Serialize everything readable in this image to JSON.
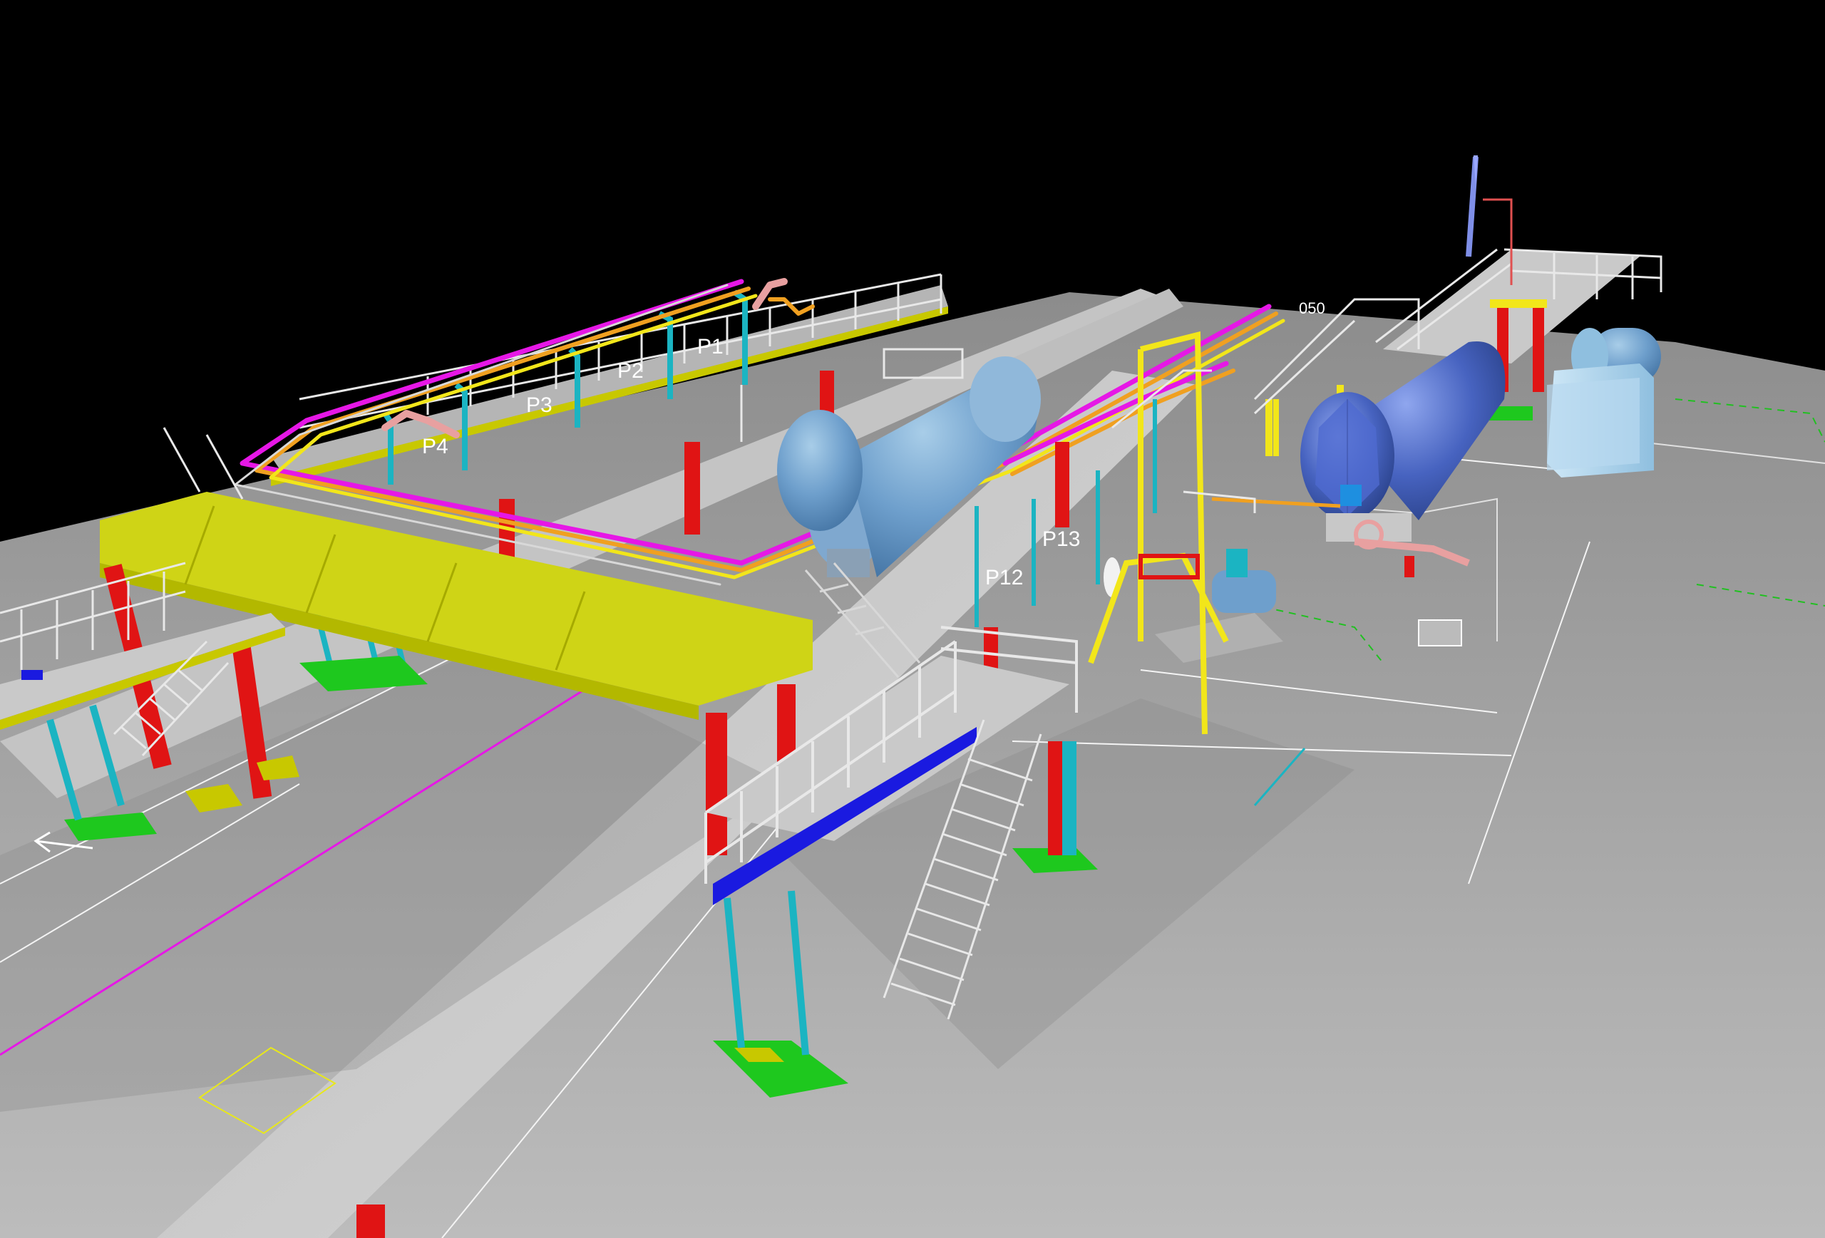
{
  "viewport": {
    "background": "#000000",
    "ground_color": "#a3a3a3",
    "colors": {
      "column_red": "#e01414",
      "column_cyan": "#1bb4c2",
      "beam_yellow": "#d8dc14",
      "pipe_magenta": "#e617e6",
      "pipe_orange": "#f0a020",
      "pipe_yellow": "#f2e61a",
      "railing_white": "#e8e8e8",
      "tank_blue": "#5a8fc4",
      "base_plate_green": "#1ec81e",
      "walkway_grey": "#c9c9c9",
      "blue_band": "#1a1ae0"
    },
    "pipe_labels": [
      "P1",
      "P2",
      "P3",
      "P4",
      "P12",
      "P13"
    ],
    "misc_label": "050"
  },
  "objects": {
    "tank_left": "horizontal-storage-tank",
    "tank_center": "horizontal-storage-tank",
    "tank_right": "horizontal-storage-tank",
    "cabinet": "equipment-cabinet",
    "stack": "vent-stack"
  }
}
